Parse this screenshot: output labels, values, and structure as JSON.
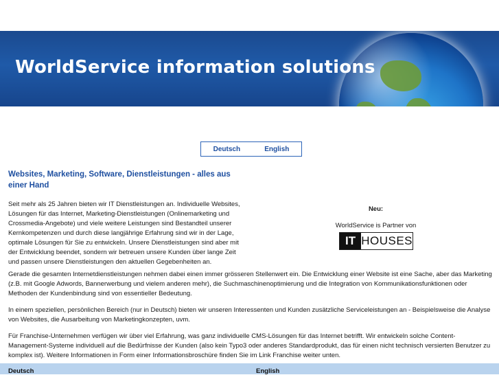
{
  "banner": {
    "title": "WorldService information solutions"
  },
  "language_switch": {
    "deutsch": "Deutsch",
    "english": "English"
  },
  "heading": "Websites, Marketing, Software, Dienstleistungen - alles aus einer Hand",
  "paragraphs": {
    "p1": "Seit mehr als 25 Jahren bieten wir IT Dienstleistungen an. Individuelle Websites, Lösungen für das Internet, Marketing-Dienstleistungen (Onlinemarketing und Crossmedia-Angebote) und viele weitere Leistungen sind Bestandteil unserer Kernkompetenzen und durch diese langjährige Erfahrung sind wir in der Lage, optimale Lösungen für Sie zu entwickeln. Unsere Dienstleistungen sind aber mit der Entwicklung beendet, sondern wir betreuen unsere Kunden über lange Zeit und passen unsere Dienstleistungen den aktuellen Gegebenheiten an.",
    "p2": "Gerade die gesamten Internetdienstleistungen nehmen dabei einen immer grösseren Stellenwert ein. Die Entwicklung einer Website ist eine Sache, aber das Marketing (z.B. mit Google Adwords, Bannerwerbung und vielem anderen mehr), die Suchmaschinenoptimierung und die Integration von Kommunikationsfunktionen oder Methoden der Kundenbindung sind von essentieller Bedeutung.",
    "p3": "In einem speziellen, persönlichen Bereich (nur in Deutsch) bieten wir unseren Interessenten und Kunden zusätzliche Serviceleistungen an - Beispielsweise die Analyse von Websites, die Ausarbeitung von Marketingkonzepten, uvm.",
    "p4": "Für Franchise-Unternehmen verfügen wir über viel Erfahrung, was ganz individuelle CMS-Lösungen für das Internet betrifft. Wir entwickeln solche Content-Management-Systeme individuell auf die Bedürfnisse der Kunden (also kein Typo3 oder anderes Standardprodukt, das für einen nicht technisch versierten Benutzer zu komplex ist). Weitere Informationen in Form einer Informationsbroschüre finden Sie im Link Franchise weiter unten."
  },
  "sidebar": {
    "neu": "Neu:",
    "partner_text": "WorldService is Partner von",
    "logo_it": "IT",
    "logo_houses": "HOUSES"
  },
  "footer": {
    "left": "Deutsch",
    "right": "English"
  },
  "colors": {
    "banner_blue": "#1f5aa8",
    "link_blue": "#1e4fa0",
    "footer_bg": "#b9d3ee"
  }
}
